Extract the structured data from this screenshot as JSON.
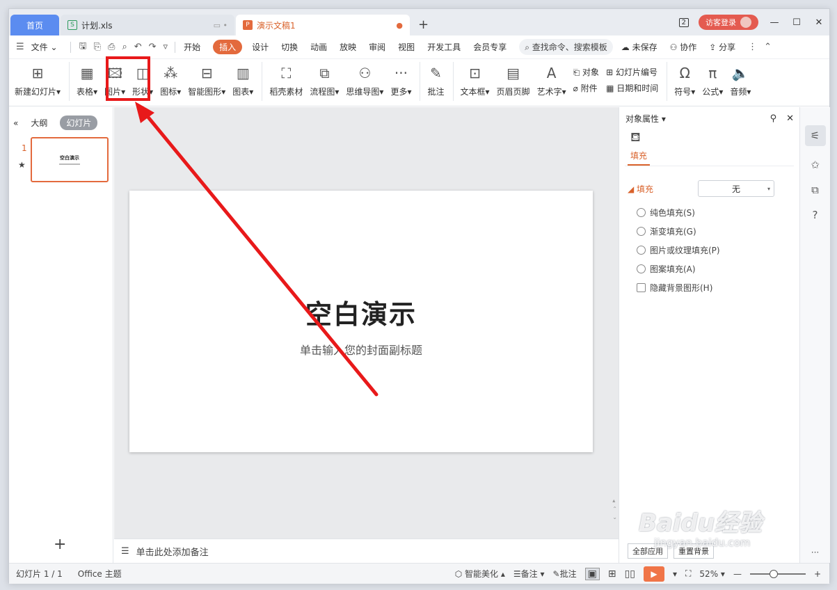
{
  "titlebar": {
    "tabs": [
      {
        "label": "首页"
      },
      {
        "label": "计划.xls"
      },
      {
        "label": "演示文稿1"
      }
    ],
    "badge": "2",
    "login": "访客登录",
    "min": "—",
    "max": "☐",
    "close": "✕"
  },
  "menu": {
    "file": "文件",
    "items": [
      "开始",
      "插入",
      "设计",
      "切换",
      "动画",
      "放映",
      "审阅",
      "视图",
      "开发工具",
      "会员专享"
    ],
    "search": "查找命令、搜索模板",
    "unsaved": "未保存",
    "collab": "协作",
    "share": "分享"
  },
  "ribbon": {
    "new_slide": "新建幻灯片",
    "table": "表格",
    "picture": "图片",
    "shape": "形状",
    "icon": "图标",
    "smart": "智能图形",
    "chart": "图表",
    "material": "稻壳素材",
    "flow": "流程图",
    "mind": "思维导图",
    "more": "更多",
    "comment": "批注",
    "textbox": "文本框",
    "header": "页眉页脚",
    "art": "艺术字",
    "object": "对象",
    "attach": "附件",
    "slide_no": "幻灯片编号",
    "datetime": "日期和时间",
    "symbol": "符号",
    "formula": "公式",
    "audio": "音频"
  },
  "leftpanel": {
    "outline": "大纲",
    "slides": "幻灯片",
    "slide_num": "1",
    "thumb_title": "空白演示"
  },
  "slide": {
    "title": "空白演示",
    "subtitle": "单击输入您的封面副标题"
  },
  "notes": "单击此处添加备注",
  "rightpanel": {
    "title": "对象属性",
    "tab": "填充",
    "section": "填充",
    "select_value": "无",
    "options": [
      "纯色填充(S)",
      "渐变填充(G)",
      "图片或纹理填充(P)",
      "图案填充(A)"
    ],
    "checkbox": "隐藏背景图形(H)",
    "btn_all": "全部应用",
    "btn_reset": "重置背景"
  },
  "statusbar": {
    "slide_info": "幻灯片 1 / 1",
    "theme": "Office 主题",
    "beautify": "智能美化",
    "notes": "备注",
    "comment": "批注",
    "zoom": "52%"
  },
  "watermark": {
    "logo": "Baidu经验",
    "url": "jingyan.baidu.com"
  },
  "colors": {
    "accent": "#e36a3d",
    "highlight": "#e8191a",
    "home_tab": "#5b8cf0"
  }
}
